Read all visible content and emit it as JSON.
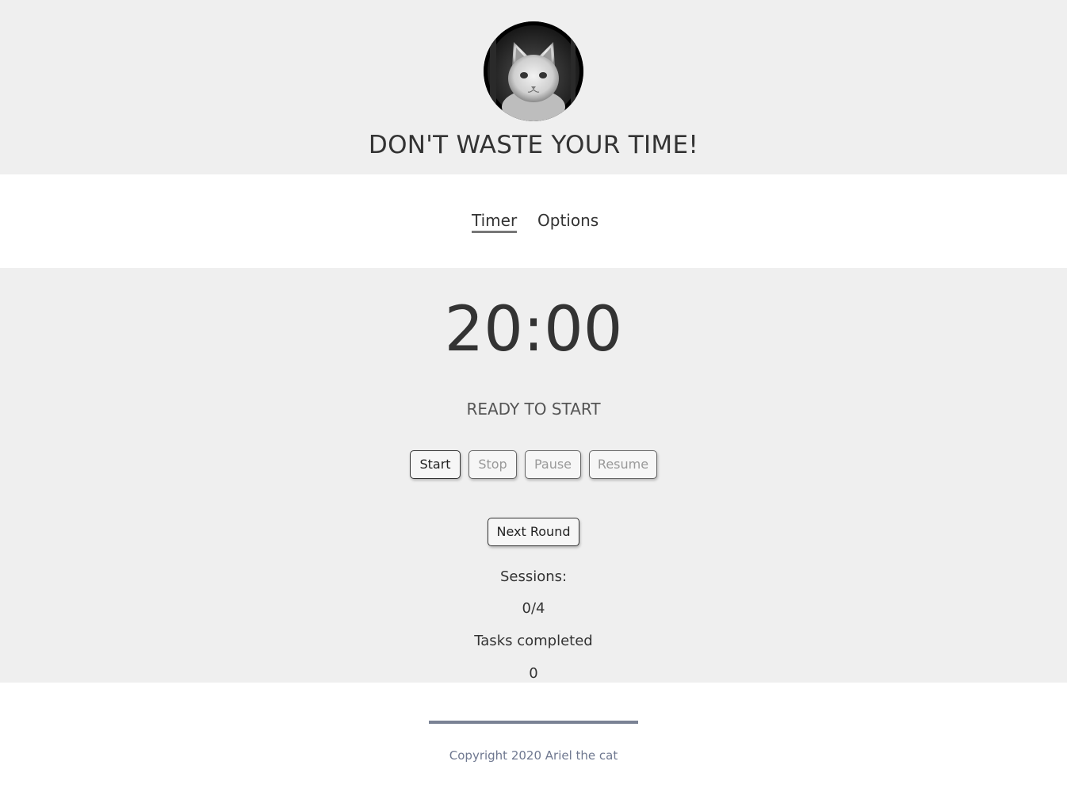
{
  "header": {
    "title": "DON'T WASTE YOUR TIME!",
    "avatar_alt": "cat"
  },
  "nav": {
    "tabs": [
      {
        "label": "Timer",
        "active": true
      },
      {
        "label": "Options",
        "active": false
      }
    ]
  },
  "timer": {
    "time": "20:00",
    "status": "READY TO START"
  },
  "controls": {
    "start": "Start",
    "stop": "Stop",
    "pause": "Pause",
    "resume": "Resume",
    "next_round": "Next Round"
  },
  "stats": {
    "sessions_label": "Sessions:",
    "sessions_value": "0/4",
    "tasks_label": "Tasks completed",
    "tasks_value": "0"
  },
  "footer": {
    "copyright": "Copyright 2020 Ariel the cat"
  },
  "colors": {
    "panel_bg": "#efefef",
    "footer_line": "#7a8294",
    "footer_text": "#6f7890"
  }
}
